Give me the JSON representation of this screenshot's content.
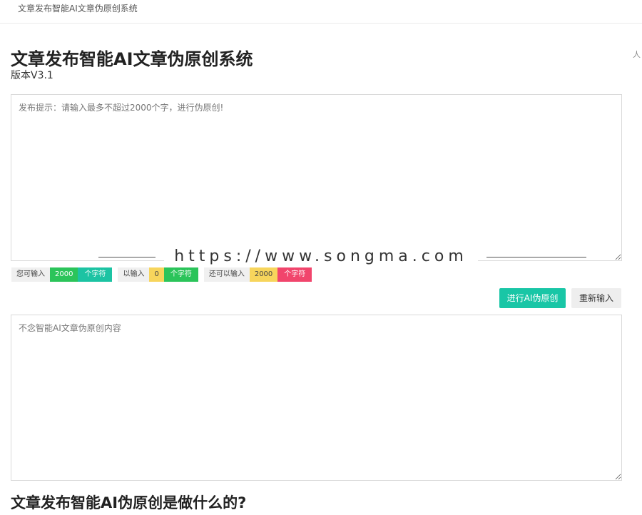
{
  "header": {
    "site_title": "文章发布智能AI文章伪原创系统"
  },
  "side_glyph": "人",
  "main": {
    "title": "文章发布智能AI文章伪原创系统",
    "version": "版本V3.1"
  },
  "input": {
    "placeholder": "发布提示：请输入最多不超过2000个字，进行伪原创!",
    "value": ""
  },
  "watermark": "https://www.songma.com",
  "counters": [
    {
      "label": "您可输入",
      "value": "2000",
      "unit": "个字符"
    },
    {
      "label": "以输入",
      "value": "0",
      "unit": "个字符"
    },
    {
      "label": "还可以输入",
      "value": "2000",
      "unit": "个字符"
    }
  ],
  "buttons": {
    "rewrite": "进行AI伪原创",
    "reset": "重新输入"
  },
  "output": {
    "placeholder": "不念智能AI文章伪原创内容",
    "value": ""
  },
  "section": {
    "heading": "文章发布智能AI伪原创是做什么的?"
  },
  "colors": {
    "accent_teal": "#19c6a6",
    "badge_green": "#2bc45a",
    "badge_yellow": "#f7d55c",
    "badge_red": "#f1456c"
  }
}
